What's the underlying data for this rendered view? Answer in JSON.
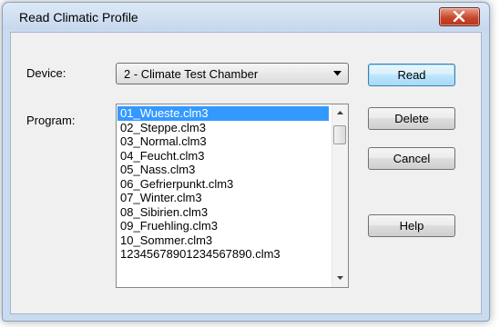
{
  "window": {
    "title": "Read Climatic Profile"
  },
  "device": {
    "label": "Device:",
    "selected": "2 - Climate Test Chamber"
  },
  "program": {
    "label": "Program:",
    "items": [
      "01_Wueste.clm3",
      "02_Steppe.clm3",
      "03_Normal.clm3",
      "04_Feucht.clm3",
      "05_Nass.clm3",
      "06_Gefrierpunkt.clm3",
      "07_Winter.clm3",
      "08_Sibirien.clm3",
      "09_Fruehling.clm3",
      "10_Sommer.clm3",
      "12345678901234567890.clm3"
    ],
    "selected_index": 0
  },
  "buttons": {
    "read": "Read",
    "delete": "Delete",
    "cancel": "Cancel",
    "help": "Help"
  }
}
